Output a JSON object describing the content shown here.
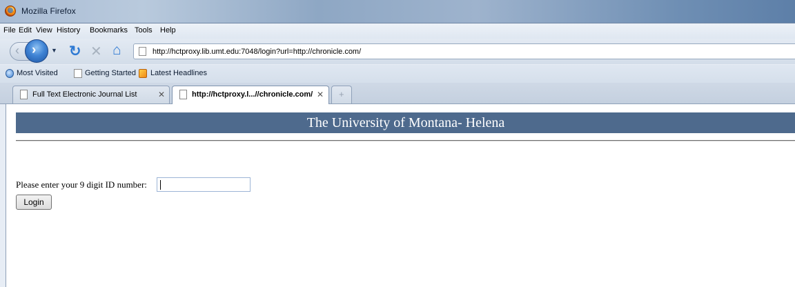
{
  "window": {
    "title": "Mozilla Firefox"
  },
  "menubar": {
    "items": [
      "File",
      "Edit",
      "View",
      "History",
      "Bookmarks",
      "Tools",
      "Help"
    ]
  },
  "navbar": {
    "url": "http://hctproxy.lib.umt.edu:7048/login?url=http://chronicle.com/",
    "icons": [
      "back-icon",
      "forward-icon",
      "history-dropdown-icon",
      "reload-icon",
      "stop-icon",
      "home-icon"
    ]
  },
  "bookmarks": {
    "items": [
      "Most Visited",
      "Getting Started",
      "Latest Headlines"
    ]
  },
  "tabs": [
    {
      "label": "Full Text Electronic Journal List",
      "active": false
    },
    {
      "label": "http://hctproxy.l...//chronicle.com/",
      "active": true
    }
  ],
  "page": {
    "header_title": "The University of Montana- Helena",
    "id_prompt": "Please enter your 9 digit ID number:",
    "id_value": "",
    "login_label": "Login"
  },
  "colors": {
    "header_banner": "#4e6a8d",
    "accent": "#2f7ad3"
  }
}
